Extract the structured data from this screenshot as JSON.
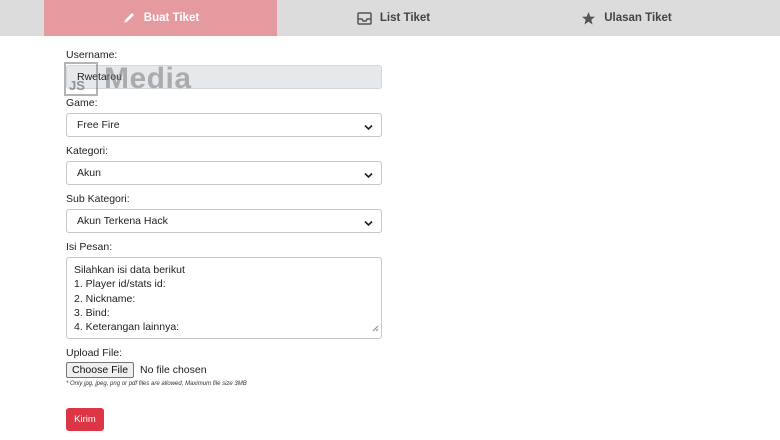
{
  "tabs": [
    {
      "label": "Buat Tiket",
      "icon": "pencil-icon",
      "active": true
    },
    {
      "label": "List Tiket",
      "icon": "inbox-icon",
      "active": false
    },
    {
      "label": "Ulasan Tiket",
      "icon": "star-icon",
      "active": false
    }
  ],
  "form": {
    "username_label": "Username:",
    "username_value": "Rwetarou",
    "game_label": "Game:",
    "game_value": "Free Fire",
    "kategori_label": "Kategori:",
    "kategori_value": "Akun",
    "subkategori_label": "Sub Kategori:",
    "subkategori_value": "Akun Terkena Hack",
    "pesan_label": "Isi Pesan:",
    "pesan_lines": [
      "Silahkan isi data berikut",
      "1. Player id/stats id:",
      "2. Nickname:",
      "3. Bind:",
      "4. Keterangan lainnya:"
    ],
    "upload_label": "Upload File:",
    "choose_file": "Choose File",
    "no_file": "No file chosen",
    "upload_note": "* Only jpg, jpeg, png or pdf files are allowed, Maximum file size 3MB",
    "submit_label": "Kirim"
  },
  "watermark": {
    "badge": "JS",
    "text": "Media"
  },
  "colors": {
    "active_tab": "#e59aa0",
    "tab_bar": "#dcdcdc",
    "submit": "#dc3545"
  }
}
